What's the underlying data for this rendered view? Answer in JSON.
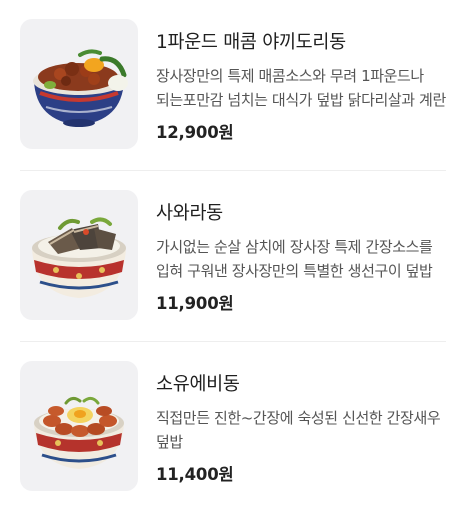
{
  "menu": {
    "items": [
      {
        "name": "1파운드 매콤 야끼도리동",
        "description": "장사장만의 특제 매콤소스와 무려 1파운드나 되는포만감 넘치는 대식가 덮밥 닭다리살과 계란",
        "price": "12,900원",
        "image_icon": "spicy-chicken-rice-bowl-image"
      },
      {
        "name": "사와라동",
        "description": "가시없는 순살 삼치에 장사장 특제 간장소스를 입혀 구워낸 장사장만의 특별한 생선구이 덮밥",
        "price": "11,900원",
        "image_icon": "mackerel-rice-bowl-image"
      },
      {
        "name": "소유에비동",
        "description": "직접만든 진한~간장에 숙성된 신선한 간장새우 덮밥",
        "price": "11,400원",
        "image_icon": "soy-shrimp-rice-bowl-image"
      }
    ]
  },
  "colors": {
    "thumbnail_bg": "#f1f1f3",
    "divider": "#eeeeee",
    "price_text": "#222222",
    "description_text": "#555555"
  }
}
